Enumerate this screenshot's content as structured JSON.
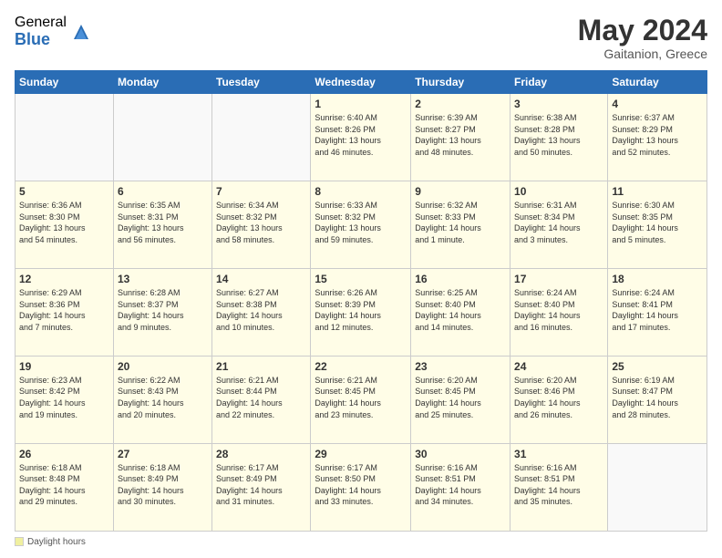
{
  "header": {
    "logo_general": "General",
    "logo_blue": "Blue",
    "month_title": "May 2024",
    "location": "Gaitanion, Greece"
  },
  "footer": {
    "daylight_label": "Daylight hours"
  },
  "days_of_week": [
    "Sunday",
    "Monday",
    "Tuesday",
    "Wednesday",
    "Thursday",
    "Friday",
    "Saturday"
  ],
  "weeks": [
    [
      {
        "day": "",
        "info": ""
      },
      {
        "day": "",
        "info": ""
      },
      {
        "day": "",
        "info": ""
      },
      {
        "day": "1",
        "info": "Sunrise: 6:40 AM\nSunset: 8:26 PM\nDaylight: 13 hours\nand 46 minutes."
      },
      {
        "day": "2",
        "info": "Sunrise: 6:39 AM\nSunset: 8:27 PM\nDaylight: 13 hours\nand 48 minutes."
      },
      {
        "day": "3",
        "info": "Sunrise: 6:38 AM\nSunset: 8:28 PM\nDaylight: 13 hours\nand 50 minutes."
      },
      {
        "day": "4",
        "info": "Sunrise: 6:37 AM\nSunset: 8:29 PM\nDaylight: 13 hours\nand 52 minutes."
      }
    ],
    [
      {
        "day": "5",
        "info": "Sunrise: 6:36 AM\nSunset: 8:30 PM\nDaylight: 13 hours\nand 54 minutes."
      },
      {
        "day": "6",
        "info": "Sunrise: 6:35 AM\nSunset: 8:31 PM\nDaylight: 13 hours\nand 56 minutes."
      },
      {
        "day": "7",
        "info": "Sunrise: 6:34 AM\nSunset: 8:32 PM\nDaylight: 13 hours\nand 58 minutes."
      },
      {
        "day": "8",
        "info": "Sunrise: 6:33 AM\nSunset: 8:32 PM\nDaylight: 13 hours\nand 59 minutes."
      },
      {
        "day": "9",
        "info": "Sunrise: 6:32 AM\nSunset: 8:33 PM\nDaylight: 14 hours\nand 1 minute."
      },
      {
        "day": "10",
        "info": "Sunrise: 6:31 AM\nSunset: 8:34 PM\nDaylight: 14 hours\nand 3 minutes."
      },
      {
        "day": "11",
        "info": "Sunrise: 6:30 AM\nSunset: 8:35 PM\nDaylight: 14 hours\nand 5 minutes."
      }
    ],
    [
      {
        "day": "12",
        "info": "Sunrise: 6:29 AM\nSunset: 8:36 PM\nDaylight: 14 hours\nand 7 minutes."
      },
      {
        "day": "13",
        "info": "Sunrise: 6:28 AM\nSunset: 8:37 PM\nDaylight: 14 hours\nand 9 minutes."
      },
      {
        "day": "14",
        "info": "Sunrise: 6:27 AM\nSunset: 8:38 PM\nDaylight: 14 hours\nand 10 minutes."
      },
      {
        "day": "15",
        "info": "Sunrise: 6:26 AM\nSunset: 8:39 PM\nDaylight: 14 hours\nand 12 minutes."
      },
      {
        "day": "16",
        "info": "Sunrise: 6:25 AM\nSunset: 8:40 PM\nDaylight: 14 hours\nand 14 minutes."
      },
      {
        "day": "17",
        "info": "Sunrise: 6:24 AM\nSunset: 8:40 PM\nDaylight: 14 hours\nand 16 minutes."
      },
      {
        "day": "18",
        "info": "Sunrise: 6:24 AM\nSunset: 8:41 PM\nDaylight: 14 hours\nand 17 minutes."
      }
    ],
    [
      {
        "day": "19",
        "info": "Sunrise: 6:23 AM\nSunset: 8:42 PM\nDaylight: 14 hours\nand 19 minutes."
      },
      {
        "day": "20",
        "info": "Sunrise: 6:22 AM\nSunset: 8:43 PM\nDaylight: 14 hours\nand 20 minutes."
      },
      {
        "day": "21",
        "info": "Sunrise: 6:21 AM\nSunset: 8:44 PM\nDaylight: 14 hours\nand 22 minutes."
      },
      {
        "day": "22",
        "info": "Sunrise: 6:21 AM\nSunset: 8:45 PM\nDaylight: 14 hours\nand 23 minutes."
      },
      {
        "day": "23",
        "info": "Sunrise: 6:20 AM\nSunset: 8:45 PM\nDaylight: 14 hours\nand 25 minutes."
      },
      {
        "day": "24",
        "info": "Sunrise: 6:20 AM\nSunset: 8:46 PM\nDaylight: 14 hours\nand 26 minutes."
      },
      {
        "day": "25",
        "info": "Sunrise: 6:19 AM\nSunset: 8:47 PM\nDaylight: 14 hours\nand 28 minutes."
      }
    ],
    [
      {
        "day": "26",
        "info": "Sunrise: 6:18 AM\nSunset: 8:48 PM\nDaylight: 14 hours\nand 29 minutes."
      },
      {
        "day": "27",
        "info": "Sunrise: 6:18 AM\nSunset: 8:49 PM\nDaylight: 14 hours\nand 30 minutes."
      },
      {
        "day": "28",
        "info": "Sunrise: 6:17 AM\nSunset: 8:49 PM\nDaylight: 14 hours\nand 31 minutes."
      },
      {
        "day": "29",
        "info": "Sunrise: 6:17 AM\nSunset: 8:50 PM\nDaylight: 14 hours\nand 33 minutes."
      },
      {
        "day": "30",
        "info": "Sunrise: 6:16 AM\nSunset: 8:51 PM\nDaylight: 14 hours\nand 34 minutes."
      },
      {
        "day": "31",
        "info": "Sunrise: 6:16 AM\nSunset: 8:51 PM\nDaylight: 14 hours\nand 35 minutes."
      },
      {
        "day": "",
        "info": ""
      }
    ]
  ]
}
